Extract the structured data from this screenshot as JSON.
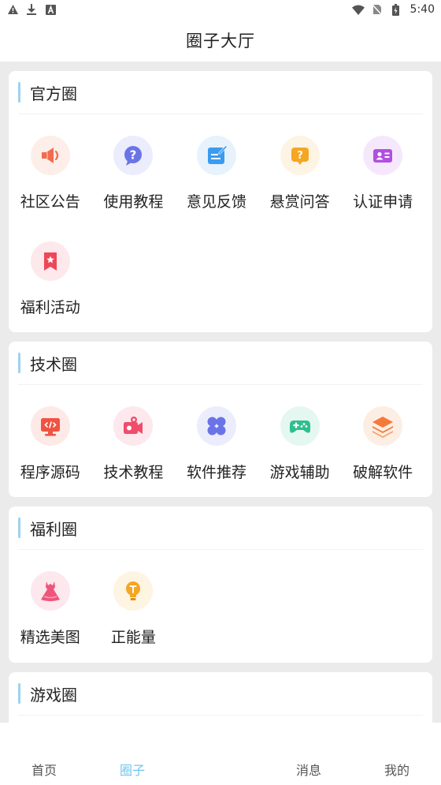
{
  "status_bar": {
    "time": "5:40",
    "left_icons": [
      "warning-icon",
      "download-icon",
      "a-icon"
    ],
    "right_icons": [
      "wifi-icon",
      "no-sim-icon",
      "battery-icon"
    ]
  },
  "app_bar": {
    "title": "圈子大厅"
  },
  "sections": [
    {
      "title": "官方圈",
      "items": [
        {
          "label": "社区公告",
          "icon": "megaphone-icon",
          "color": "#f26b4e",
          "bg": "#fdeee9"
        },
        {
          "label": "使用教程",
          "icon": "question-chat-icon",
          "color": "#6b74e6",
          "bg": "#ebedfc"
        },
        {
          "label": "意见反馈",
          "icon": "feedback-edit-icon",
          "color": "#3a9bf0",
          "bg": "#e7f2fd"
        },
        {
          "label": "悬赏问答",
          "icon": "reward-question-icon",
          "color": "#f5a623",
          "bg": "#fef4e4"
        },
        {
          "label": "认证申请",
          "icon": "id-card-icon",
          "color": "#b14fe0",
          "bg": "#f6e8fc"
        },
        {
          "label": "福利活动",
          "icon": "bookmark-star-icon",
          "color": "#ee4758",
          "bg": "#fde9eb"
        }
      ]
    },
    {
      "title": "技术圈",
      "items": [
        {
          "label": "程序源码",
          "icon": "code-monitor-icon",
          "color": "#ef5342",
          "bg": "#fdeae7"
        },
        {
          "label": "技术教程",
          "icon": "video-camera-icon",
          "color": "#f04c6b",
          "bg": "#fde8ed"
        },
        {
          "label": "软件推荐",
          "icon": "apps-grid-icon",
          "color": "#6b74e6",
          "bg": "#ebedfc"
        },
        {
          "label": "游戏辅助",
          "icon": "gamepad-icon",
          "color": "#2fbf8f",
          "bg": "#e5f7f1"
        },
        {
          "label": "破解软件",
          "icon": "layers-icon",
          "color": "#f47a3a",
          "bg": "#fdeee4"
        }
      ]
    },
    {
      "title": "福利圈",
      "items": [
        {
          "label": "精选美图",
          "icon": "dress-icon",
          "color": "#f0547a",
          "bg": "#fde8ee"
        },
        {
          "label": "正能量",
          "icon": "lightbulb-icon",
          "color": "#f5a623",
          "bg": "#fef4e2"
        }
      ]
    },
    {
      "title": "游戏圈",
      "items": []
    }
  ],
  "tab_bar": {
    "active_color": "#6cc6ee",
    "tabs": [
      {
        "label": "首页",
        "active": false
      },
      {
        "label": "圈子",
        "active": true
      },
      {
        "label": "消息",
        "active": false
      },
      {
        "label": "我的",
        "active": false
      }
    ]
  }
}
